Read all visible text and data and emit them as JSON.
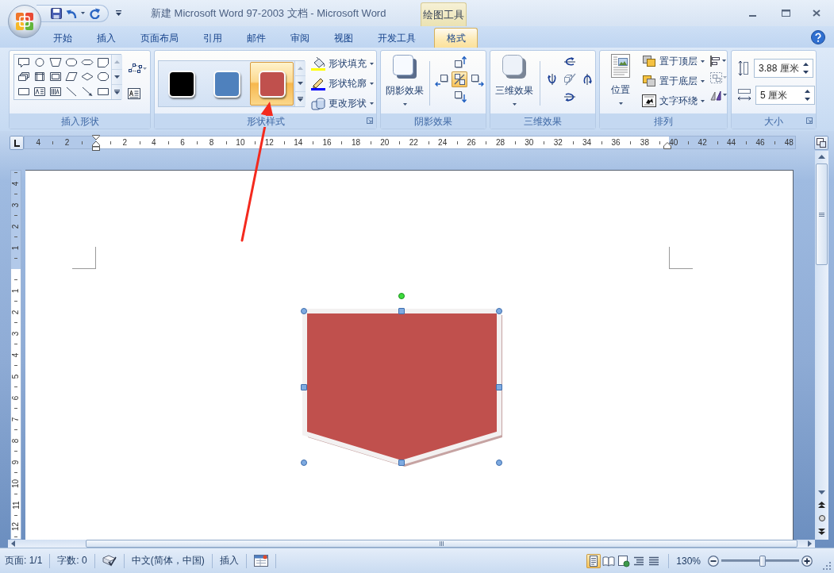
{
  "window": {
    "title": "新建 Microsoft Word 97-2003 文档 - Microsoft Word"
  },
  "tabs": [
    {
      "label": "开始",
      "selected": false
    },
    {
      "label": "插入",
      "selected": false
    },
    {
      "label": "页面布局",
      "selected": false
    },
    {
      "label": "引用",
      "selected": false
    },
    {
      "label": "邮件",
      "selected": false
    },
    {
      "label": "审阅",
      "selected": false
    },
    {
      "label": "视图",
      "selected": false
    },
    {
      "label": "开发工具",
      "selected": false
    }
  ],
  "context_tab_group": {
    "label": "绘图工具",
    "tabs": [
      {
        "label": "格式",
        "selected": true
      }
    ]
  },
  "ribbon": {
    "insert_shapes": {
      "label": "插入形状"
    },
    "shape_styles": {
      "label": "形状样式",
      "swatches": [
        {
          "color": "#000000",
          "selected": false
        },
        {
          "color": "#4f81bd",
          "selected": false
        },
        {
          "color": "#c0504d",
          "selected": true
        }
      ],
      "commands": [
        "形状填充",
        "形状轮廓",
        "更改形状"
      ]
    },
    "shadow_effects": {
      "label": "阴影效果",
      "button": "阴影效果",
      "toggle": {
        "on": true
      }
    },
    "three_d_effects": {
      "label": "三维效果",
      "button": "三维效果",
      "toggle": {
        "on": false
      }
    },
    "arrange": {
      "label": "排列",
      "button": "位置",
      "commands": [
        "置于顶层",
        "置于底层",
        "文字环绕"
      ]
    },
    "size": {
      "label": "大小",
      "height": "3.88 厘米",
      "width": "5 厘米"
    }
  },
  "horizontal_ruler": {
    "left_labels": [
      "4",
      "2"
    ],
    "right_labels": [
      "2",
      "4",
      "6",
      "8",
      "10",
      "12",
      "14",
      "16",
      "18",
      "20",
      "22",
      "24",
      "26",
      "28",
      "30",
      "32",
      "34",
      "36",
      "38",
      "40",
      "42",
      "44",
      "46",
      "48"
    ]
  },
  "vertical_ruler": {
    "top_labels": [
      "4",
      "3",
      "2",
      "1"
    ],
    "labels": [
      "1",
      "2",
      "3",
      "4",
      "5",
      "6",
      "7",
      "8",
      "9",
      "10",
      "11",
      "12"
    ]
  },
  "document": {
    "shape": {
      "selected": true
    }
  },
  "status_bar": {
    "page": "页面: 1/1",
    "words": "字数: 0",
    "language": "中文(简体，中国)",
    "mode": "插入",
    "views": [
      {
        "selected": true
      },
      {
        "selected": false
      },
      {
        "selected": false
      },
      {
        "selected": false
      },
      {
        "selected": false
      }
    ],
    "zoom": "130%",
    "zoom_slider": {
      "level": 0.53
    }
  }
}
